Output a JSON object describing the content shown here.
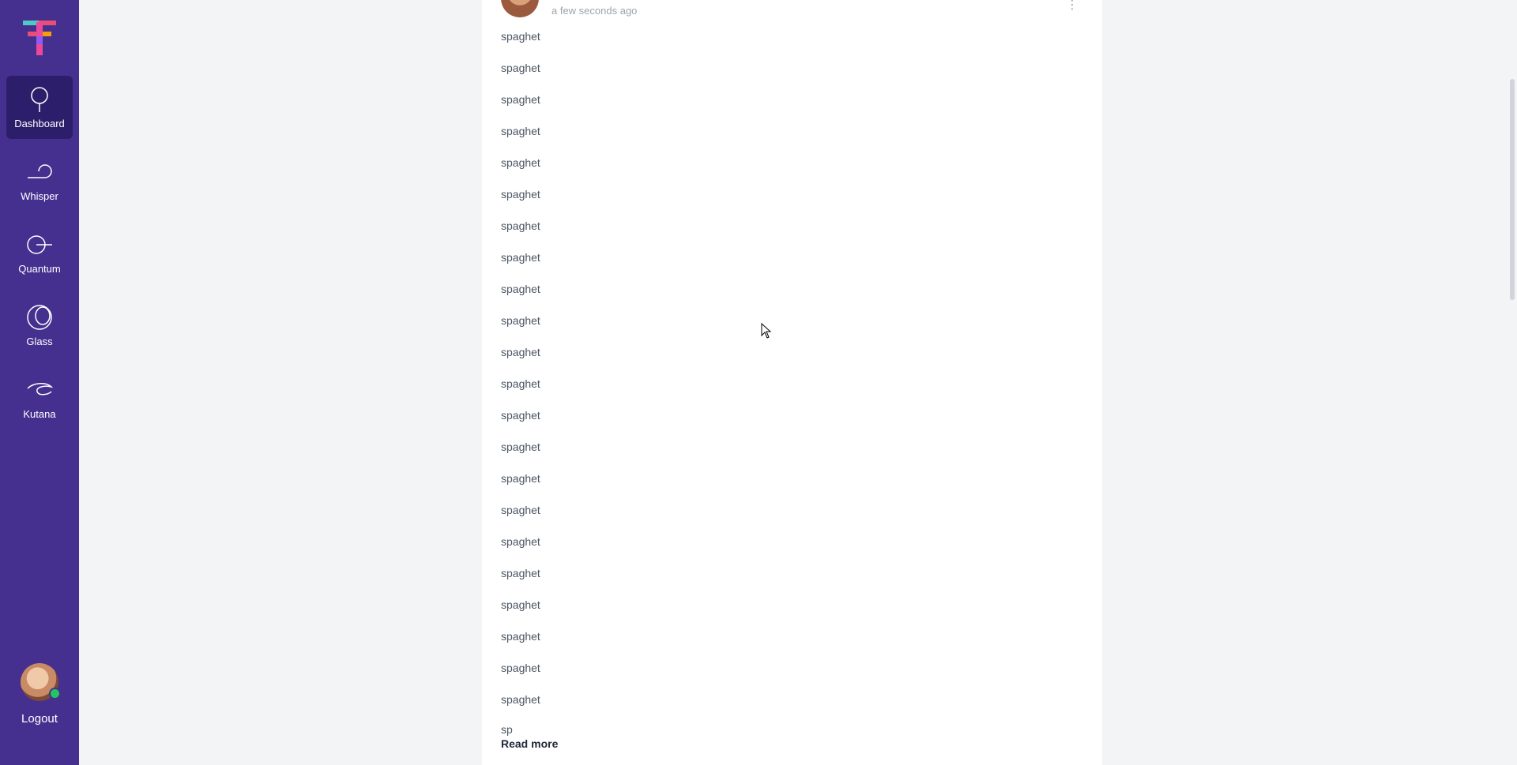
{
  "sidebar": {
    "nav": [
      {
        "label": "Dashboard",
        "icon": "dashboard-icon",
        "active": true
      },
      {
        "label": "Whisper",
        "icon": "whisper-icon",
        "active": false
      },
      {
        "label": "Quantum",
        "icon": "quantum-icon",
        "active": false
      },
      {
        "label": "Glass",
        "icon": "glass-icon",
        "active": false
      },
      {
        "label": "Kutana",
        "icon": "kutana-icon",
        "active": false
      }
    ],
    "logout_label": "Logout"
  },
  "post": {
    "time": "a few seconds ago",
    "lines": [
      "spaghet",
      "spaghet",
      "spaghet",
      "spaghet",
      "spaghet",
      "spaghet",
      "spaghet",
      "spaghet",
      "spaghet",
      "spaghet",
      "spaghet",
      "spaghet",
      "spaghet",
      "spaghet",
      "spaghet",
      "spaghet",
      "spaghet",
      "spaghet",
      "spaghet",
      "spaghet",
      "spaghet",
      "spaghet"
    ],
    "tail": "sp",
    "read_more": "Read more"
  },
  "colors": {
    "sidebar": "#45308f",
    "sidebar_active": "#2c1e6b",
    "online": "#22c55e"
  }
}
